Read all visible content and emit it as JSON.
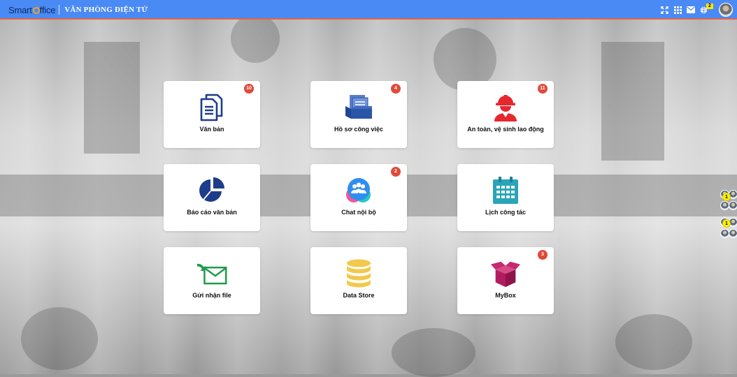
{
  "header": {
    "logo_prefix": "Smart",
    "logo_suffix": "ffice",
    "title": "VĂN PHÒNG ĐIỆN TỬ",
    "icons": [
      "fullscreen-icon",
      "apps-grid-icon",
      "mail-icon",
      "globe-icon"
    ],
    "notification_count": "2",
    "accent_color": "#4a8af4",
    "border_color": "#e2634b"
  },
  "tiles": [
    {
      "label": "Văn bản",
      "badge": "10",
      "icon": "document-stack-icon",
      "color": "#1e3c8c"
    },
    {
      "label": "Hồ sơ công việc",
      "badge": "4",
      "icon": "file-tray-icon",
      "color": "#2b56a8"
    },
    {
      "label": "An toàn, vệ sinh lao động",
      "badge": "11",
      "icon": "worker-helmet-icon",
      "color": "#e8262d"
    },
    {
      "label": "Báo cáo văn bản",
      "badge": "",
      "icon": "pie-chart-icon",
      "color": "#1e3c8c"
    },
    {
      "label": "Chat nội bộ",
      "badge": "2",
      "icon": "group-chat-icon",
      "color": "#2f8ef0"
    },
    {
      "label": "Lịch công tác",
      "badge": "",
      "icon": "calendar-icon",
      "color": "#2aa4b8"
    },
    {
      "label": "Gửi nhận file",
      "badge": "",
      "icon": "send-mail-icon",
      "color": "#1f9a4c"
    },
    {
      "label": "Data Store",
      "badge": "",
      "icon": "database-icon",
      "color": "#f2c94c"
    },
    {
      "label": "MyBox",
      "badge": "3",
      "icon": "open-box-icon",
      "color": "#b21b5f"
    }
  ],
  "side_chats": [
    {
      "unread": "1"
    },
    {
      "unread": "1"
    }
  ]
}
